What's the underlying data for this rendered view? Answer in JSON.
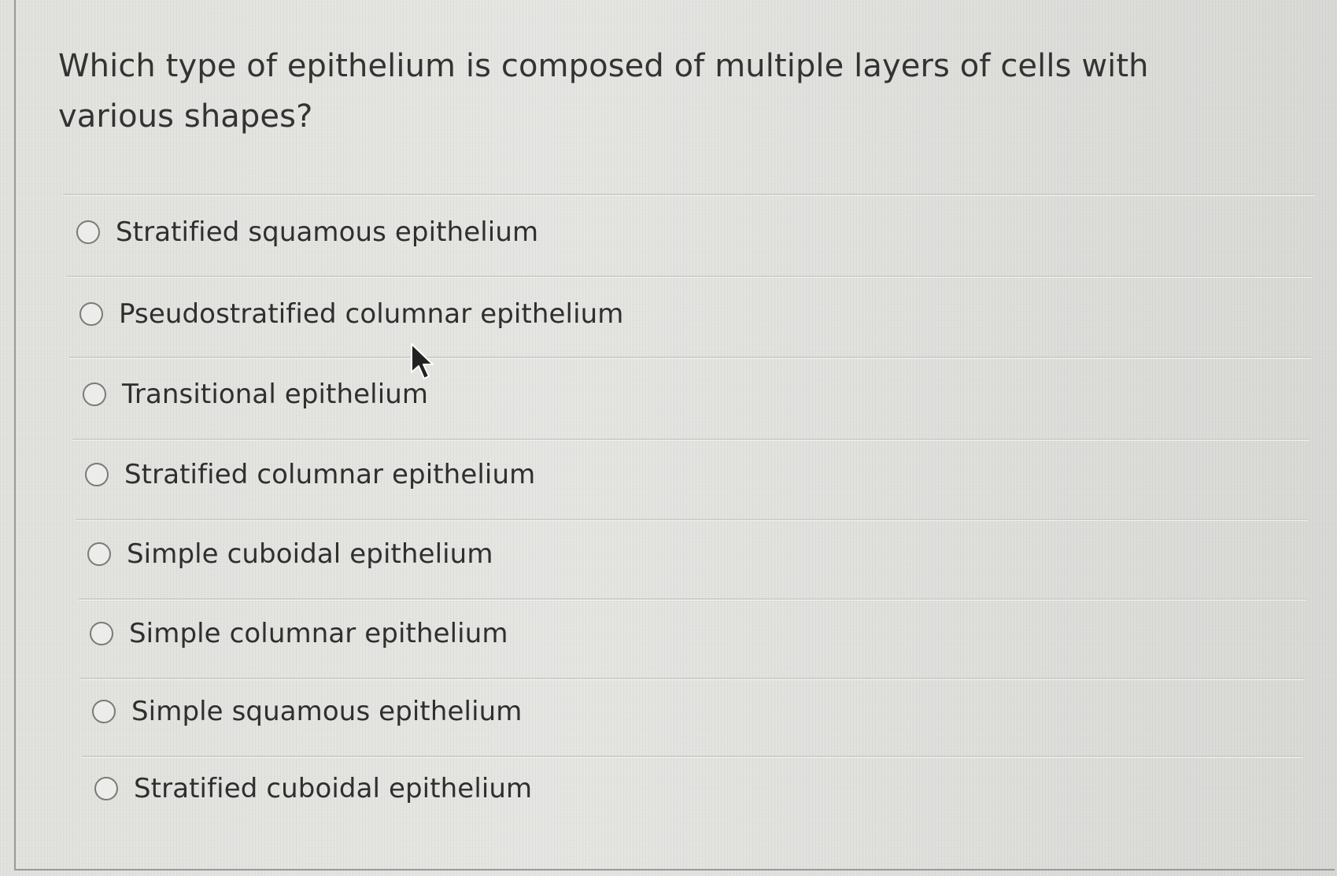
{
  "question": {
    "text": "Which type of epithelium is composed of multiple layers of cells with various shapes?"
  },
  "answers": [
    {
      "label": "Stratified squamous epithelium",
      "selected": false
    },
    {
      "label": "Pseudostratified columnar epithelium",
      "selected": false
    },
    {
      "label": "Transitional epithelium",
      "selected": false
    },
    {
      "label": "Stratified columnar epithelium",
      "selected": false
    },
    {
      "label": "Simple cuboidal epithelium",
      "selected": false
    },
    {
      "label": "Simple columnar epithelium",
      "selected": false
    },
    {
      "label": "Simple squamous epithelium",
      "selected": false
    },
    {
      "label": "Stratified cuboidal epithelium",
      "selected": false
    }
  ],
  "icons": {
    "radio": "radio-button-icon",
    "cursor": "mouse-pointer-icon"
  },
  "colors": {
    "background": "#e3e3e0",
    "text": "#333333",
    "radio_border": "#7a7a78",
    "divider": "#cfcfcc"
  }
}
